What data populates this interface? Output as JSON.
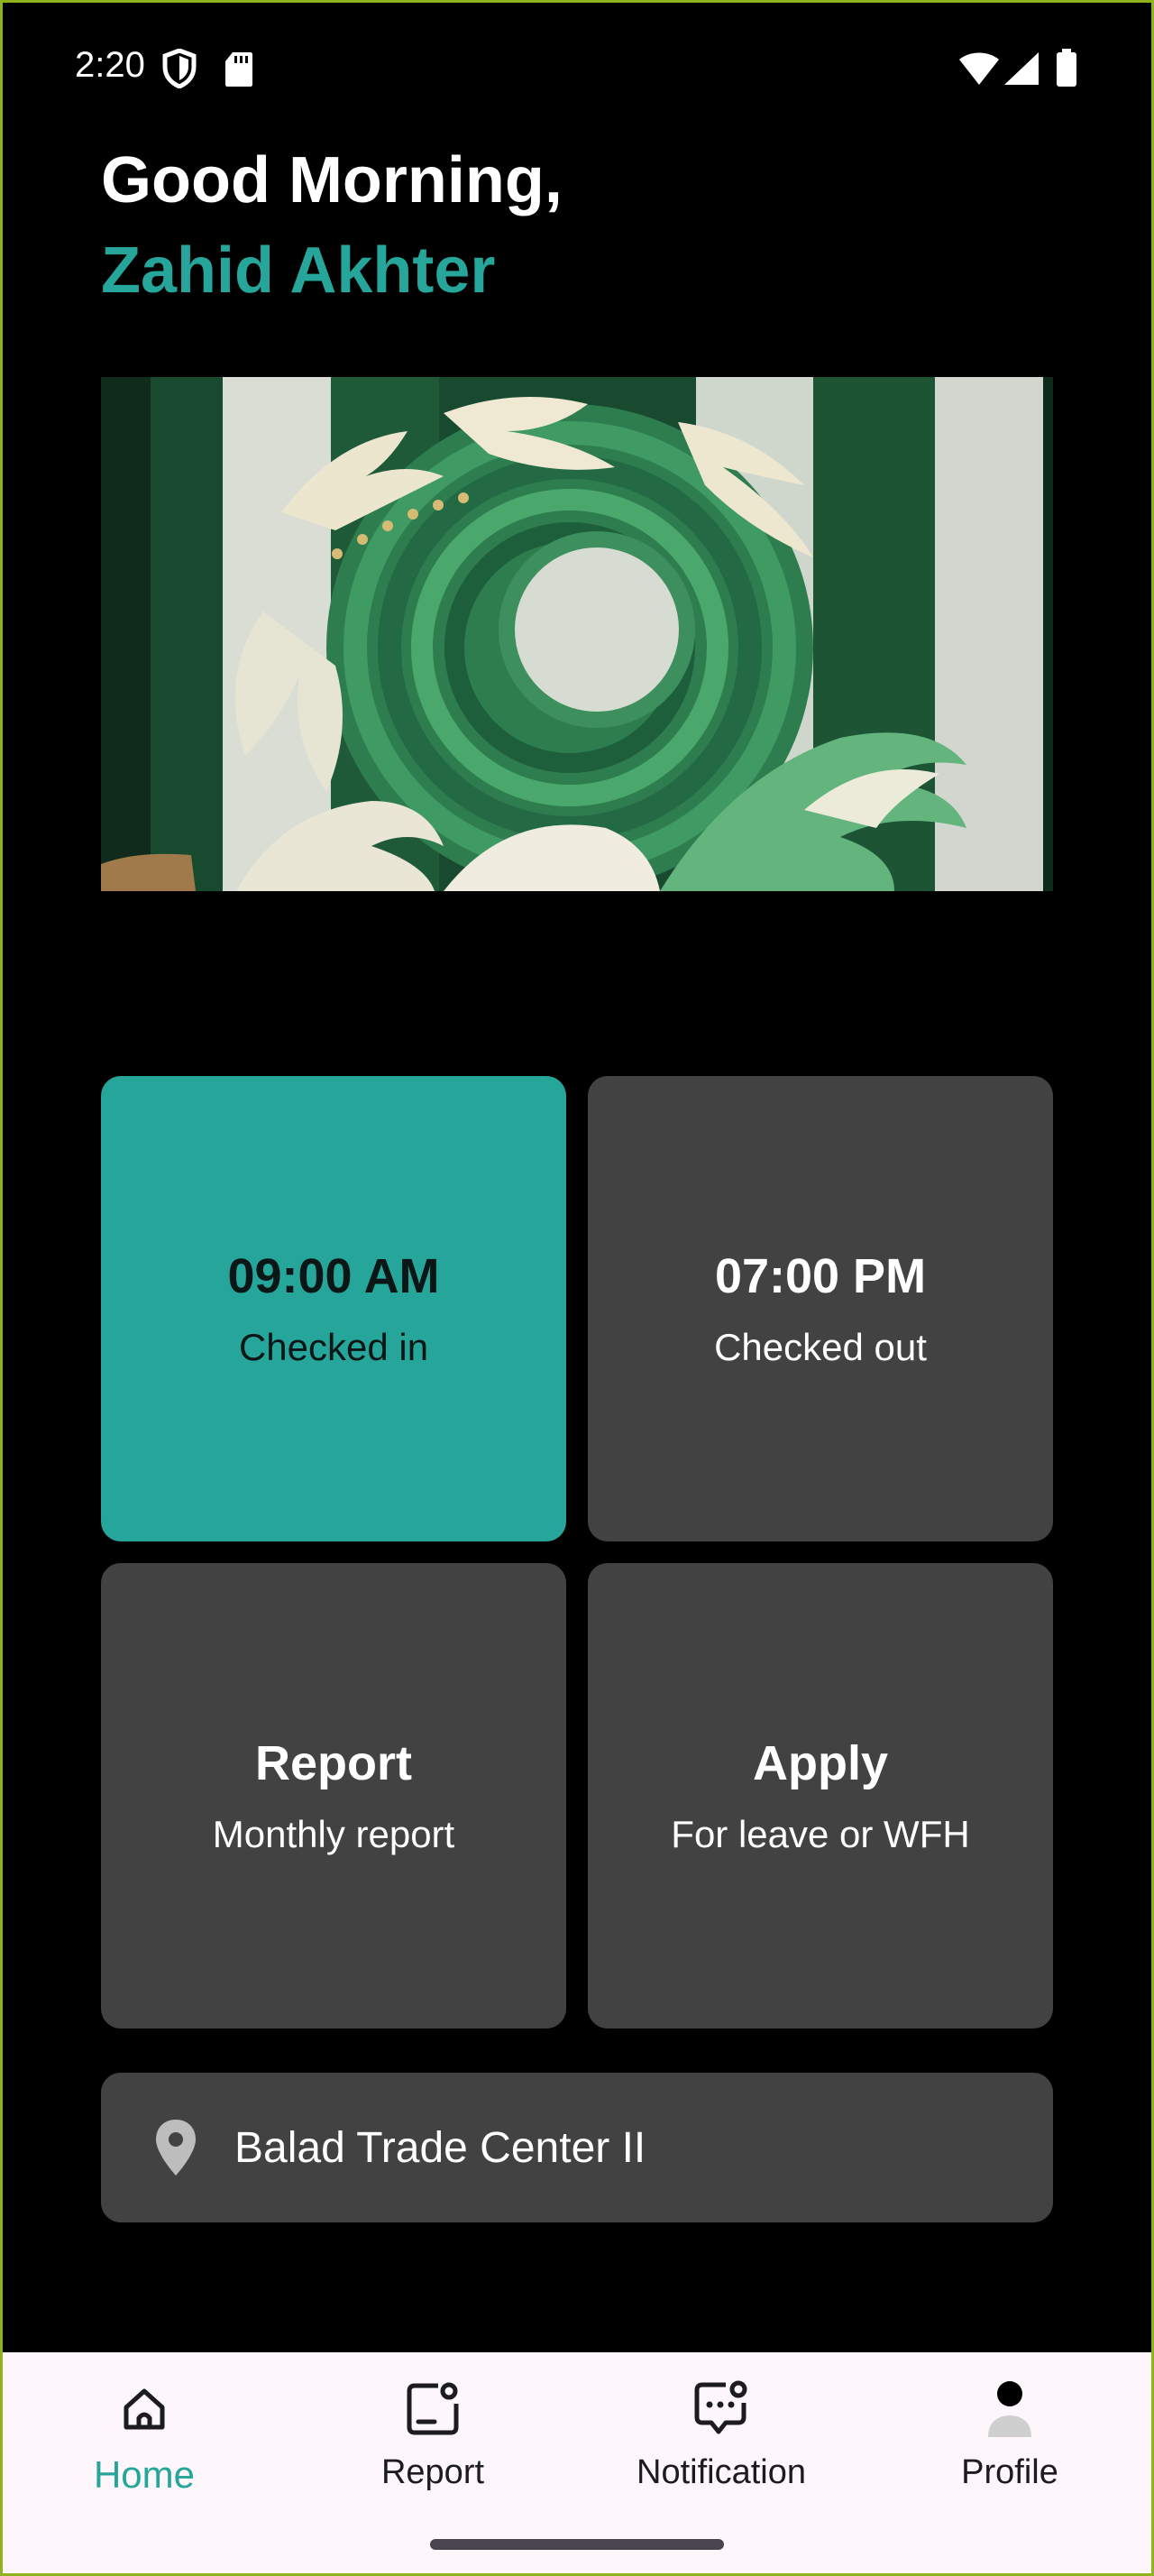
{
  "status_bar": {
    "time": "2:20",
    "icons": [
      "shield-icon",
      "sd-card-icon",
      "wifi-icon",
      "signal-icon",
      "battery-icon"
    ]
  },
  "greeting": {
    "salutation": "Good Morning,",
    "name": "Zahid Akhter"
  },
  "banner": {
    "image": "green-ceramic-wave-sculpture"
  },
  "cards": {
    "check_in": {
      "time": "09:00 AM",
      "label": "Checked in"
    },
    "check_out": {
      "time": "07:00 PM",
      "label": "Checked out"
    },
    "report": {
      "title": "Report",
      "subtitle": "Monthly report"
    },
    "apply": {
      "title": "Apply",
      "subtitle": "For leave or WFH"
    }
  },
  "location": {
    "icon": "location-pin-icon",
    "name": "Balad Trade Center II"
  },
  "bottom_nav": {
    "items": [
      {
        "label": "Home",
        "icon": "home-icon",
        "active": true
      },
      {
        "label": "Report",
        "icon": "report-icon",
        "active": false
      },
      {
        "label": "Notification",
        "icon": "notification-icon",
        "active": false
      },
      {
        "label": "Profile",
        "icon": "profile-icon",
        "active": false
      }
    ]
  },
  "colors": {
    "accent": "#26a69a",
    "card": "#424242",
    "background": "#000000",
    "nav_background": "#fdf6fb"
  }
}
